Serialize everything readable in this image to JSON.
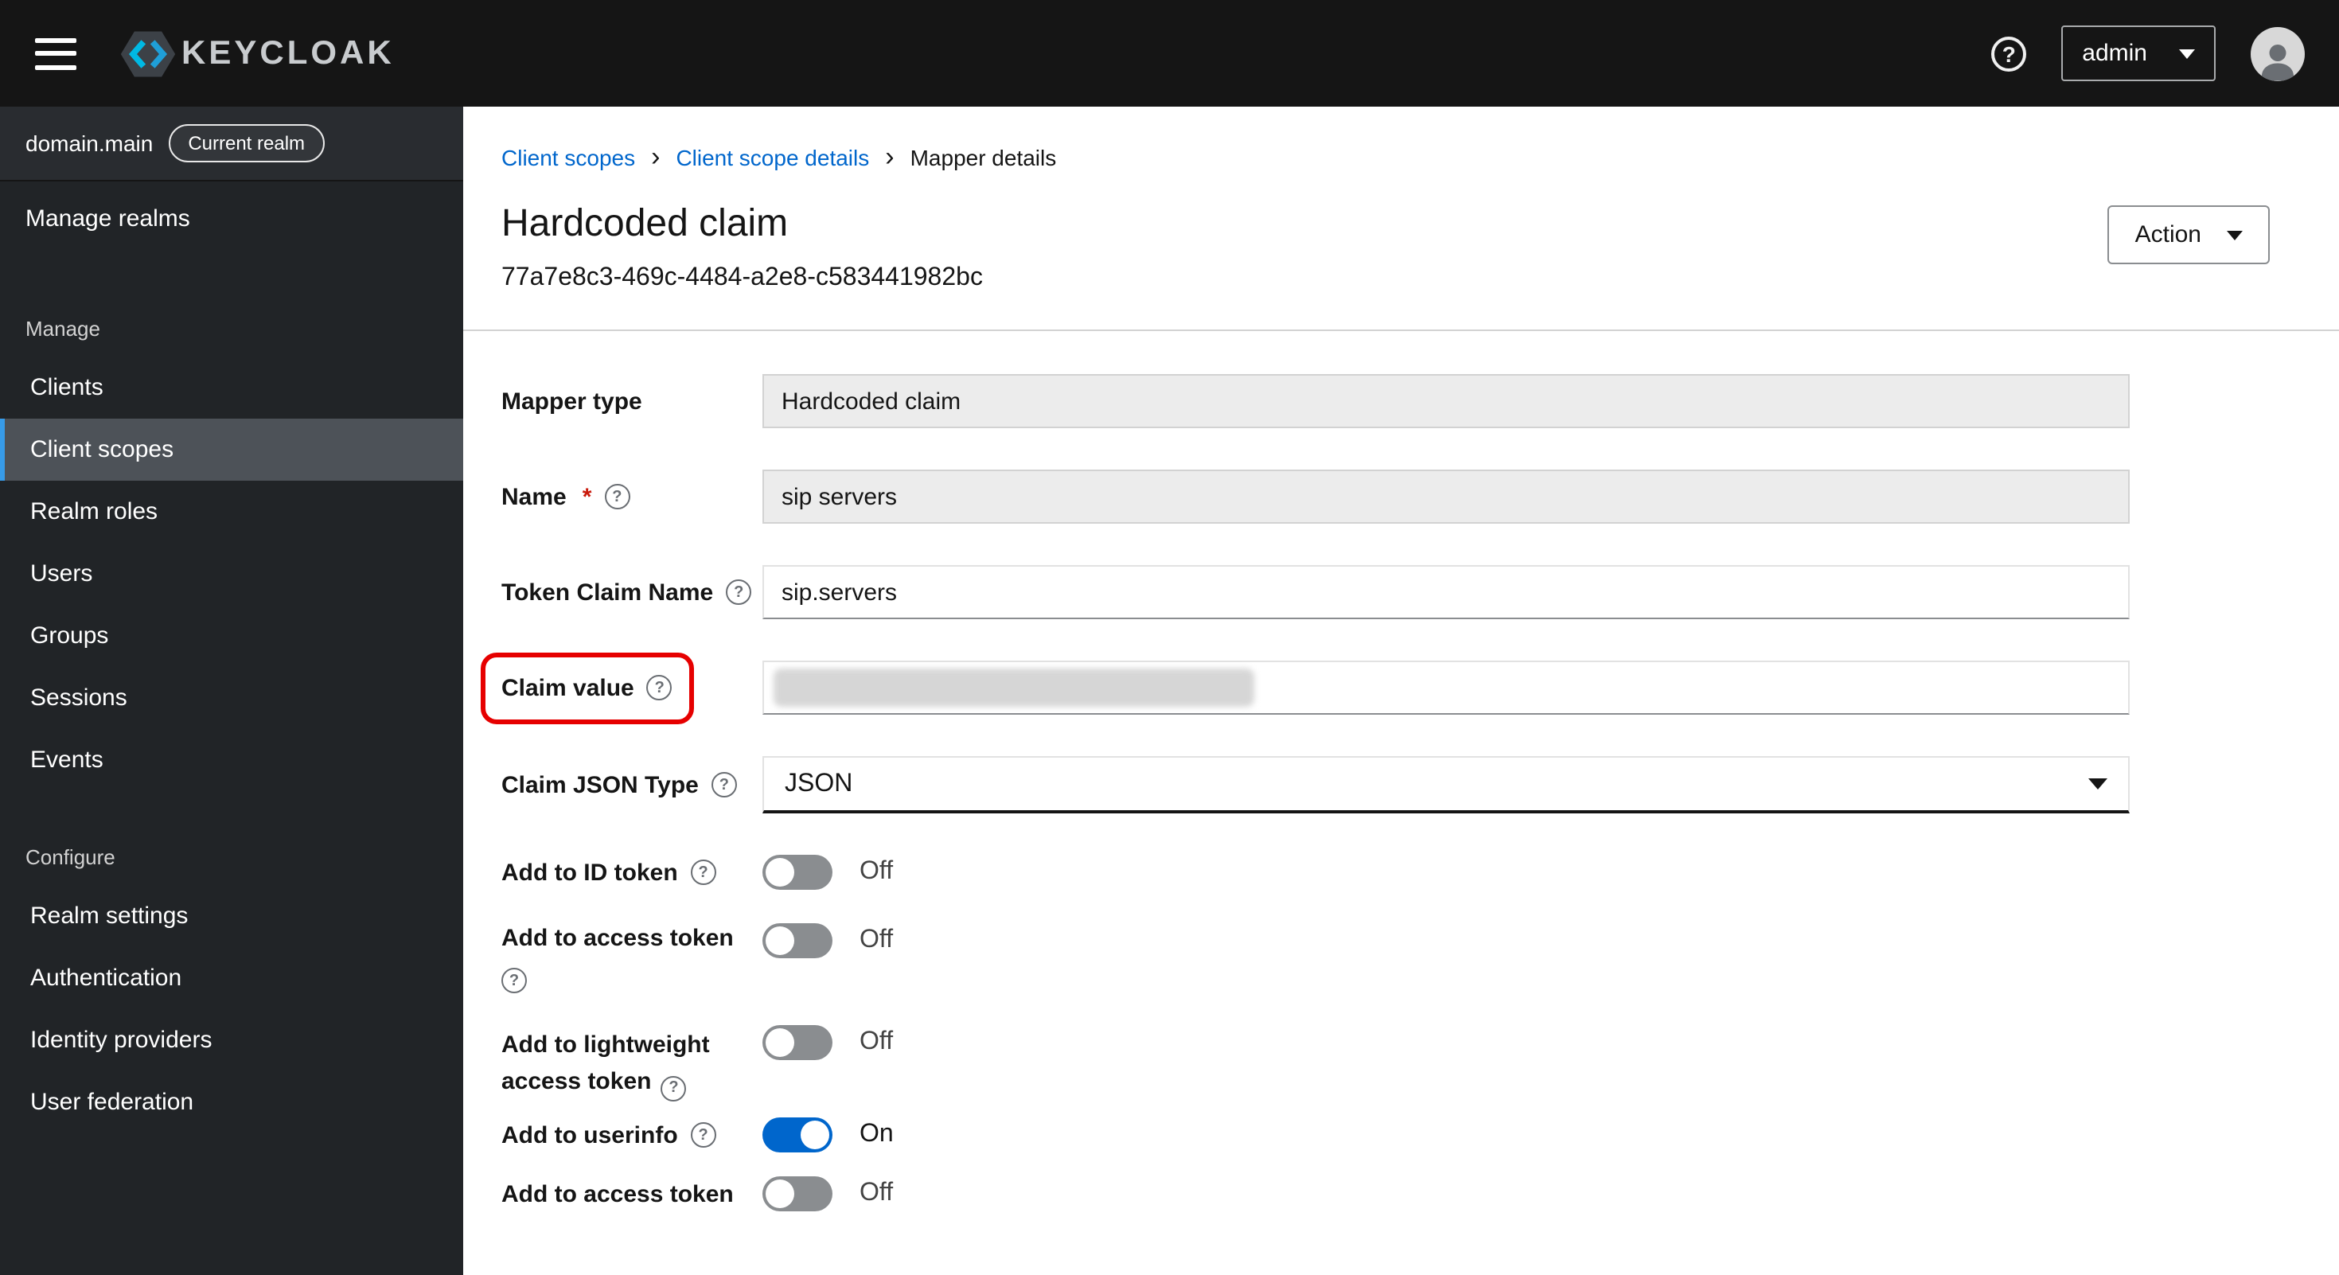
{
  "header": {
    "brand": "KEYCLOAK",
    "user": "admin"
  },
  "sidebar": {
    "realm_name": "domain.main",
    "realm_badge": "Current realm",
    "manage_realms": "Manage realms",
    "manage_label": "Manage",
    "manage_items": [
      "Clients",
      "Client scopes",
      "Realm roles",
      "Users",
      "Groups",
      "Sessions",
      "Events"
    ],
    "configure_label": "Configure",
    "configure_items": [
      "Realm settings",
      "Authentication",
      "Identity providers",
      "User federation"
    ],
    "current_item": "Client scopes"
  },
  "breadcrumb": {
    "items": [
      "Client scopes",
      "Client scope details",
      "Mapper details"
    ]
  },
  "page": {
    "title": "Hardcoded claim",
    "mapper_id": "77a7e8c3-469c-4484-a2e8-c583441982bc",
    "action_label": "Action"
  },
  "form": {
    "mapper_type": {
      "label": "Mapper type",
      "value": "Hardcoded claim"
    },
    "name": {
      "label": "Name",
      "required_marker": "*",
      "value": "sip servers"
    },
    "token_claim_name": {
      "label": "Token Claim Name",
      "value": "sip.servers"
    },
    "claim_value": {
      "label": "Claim value",
      "value": "",
      "redacted": true
    },
    "claim_json_type": {
      "label": "Claim JSON Type",
      "value": "JSON"
    },
    "toggles": [
      {
        "label": "Add to ID token",
        "on": false,
        "state_label": "Off"
      },
      {
        "label": "Add to access token",
        "on": false,
        "state_label": "Off"
      },
      {
        "label": "Add to lightweight access token",
        "on": false,
        "state_label": "Off"
      },
      {
        "label": "Add to userinfo",
        "on": true,
        "state_label": "On"
      },
      {
        "label": "Add to access token",
        "on": false,
        "state_label": "Off"
      }
    ]
  },
  "colors": {
    "header_bg": "#151515",
    "sidebar_bg": "#212427",
    "nav_current_bg": "#4d5258",
    "nav_current_accent": "#379be8",
    "link_blue": "#0066cc",
    "toggle_on": "#0066cc",
    "toggle_off": "#8a8d90",
    "annotation_red": "#e60000",
    "logo_cyan": "#00b9e4"
  }
}
